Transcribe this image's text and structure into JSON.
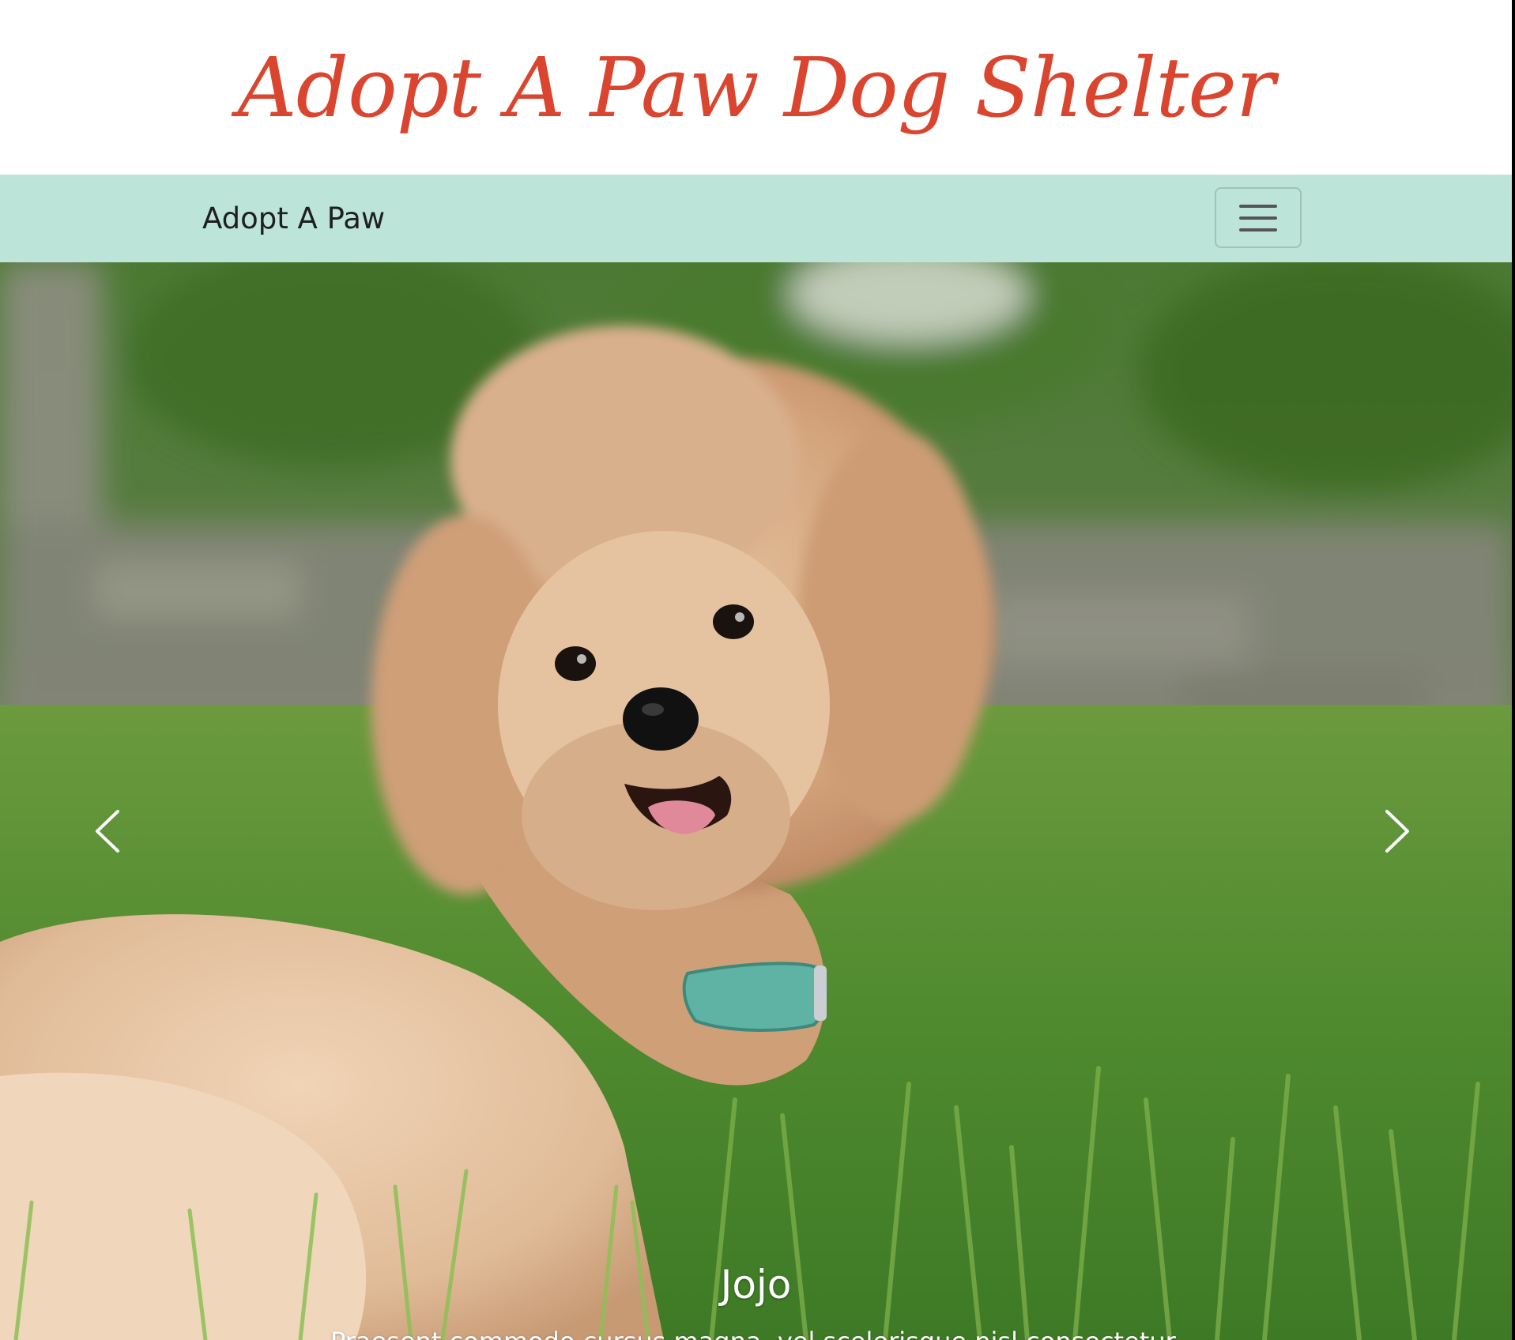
{
  "header": {
    "title": "Adopt A Paw Dog Shelter"
  },
  "navbar": {
    "brand": "Adopt A Paw",
    "toggler_icon": "hamburger-menu-icon"
  },
  "carousel": {
    "image": "dog-photo",
    "prev_icon": "chevron-left-icon",
    "next_icon": "chevron-right-icon",
    "slide": {
      "title": "Jojo",
      "text": "Praesent commodo cursus magna, vel scelerisque nisl consectetur."
    }
  },
  "colors": {
    "title": "#d9452f",
    "navbar_bg": "#bde4d8",
    "caption": "#ffffff"
  }
}
